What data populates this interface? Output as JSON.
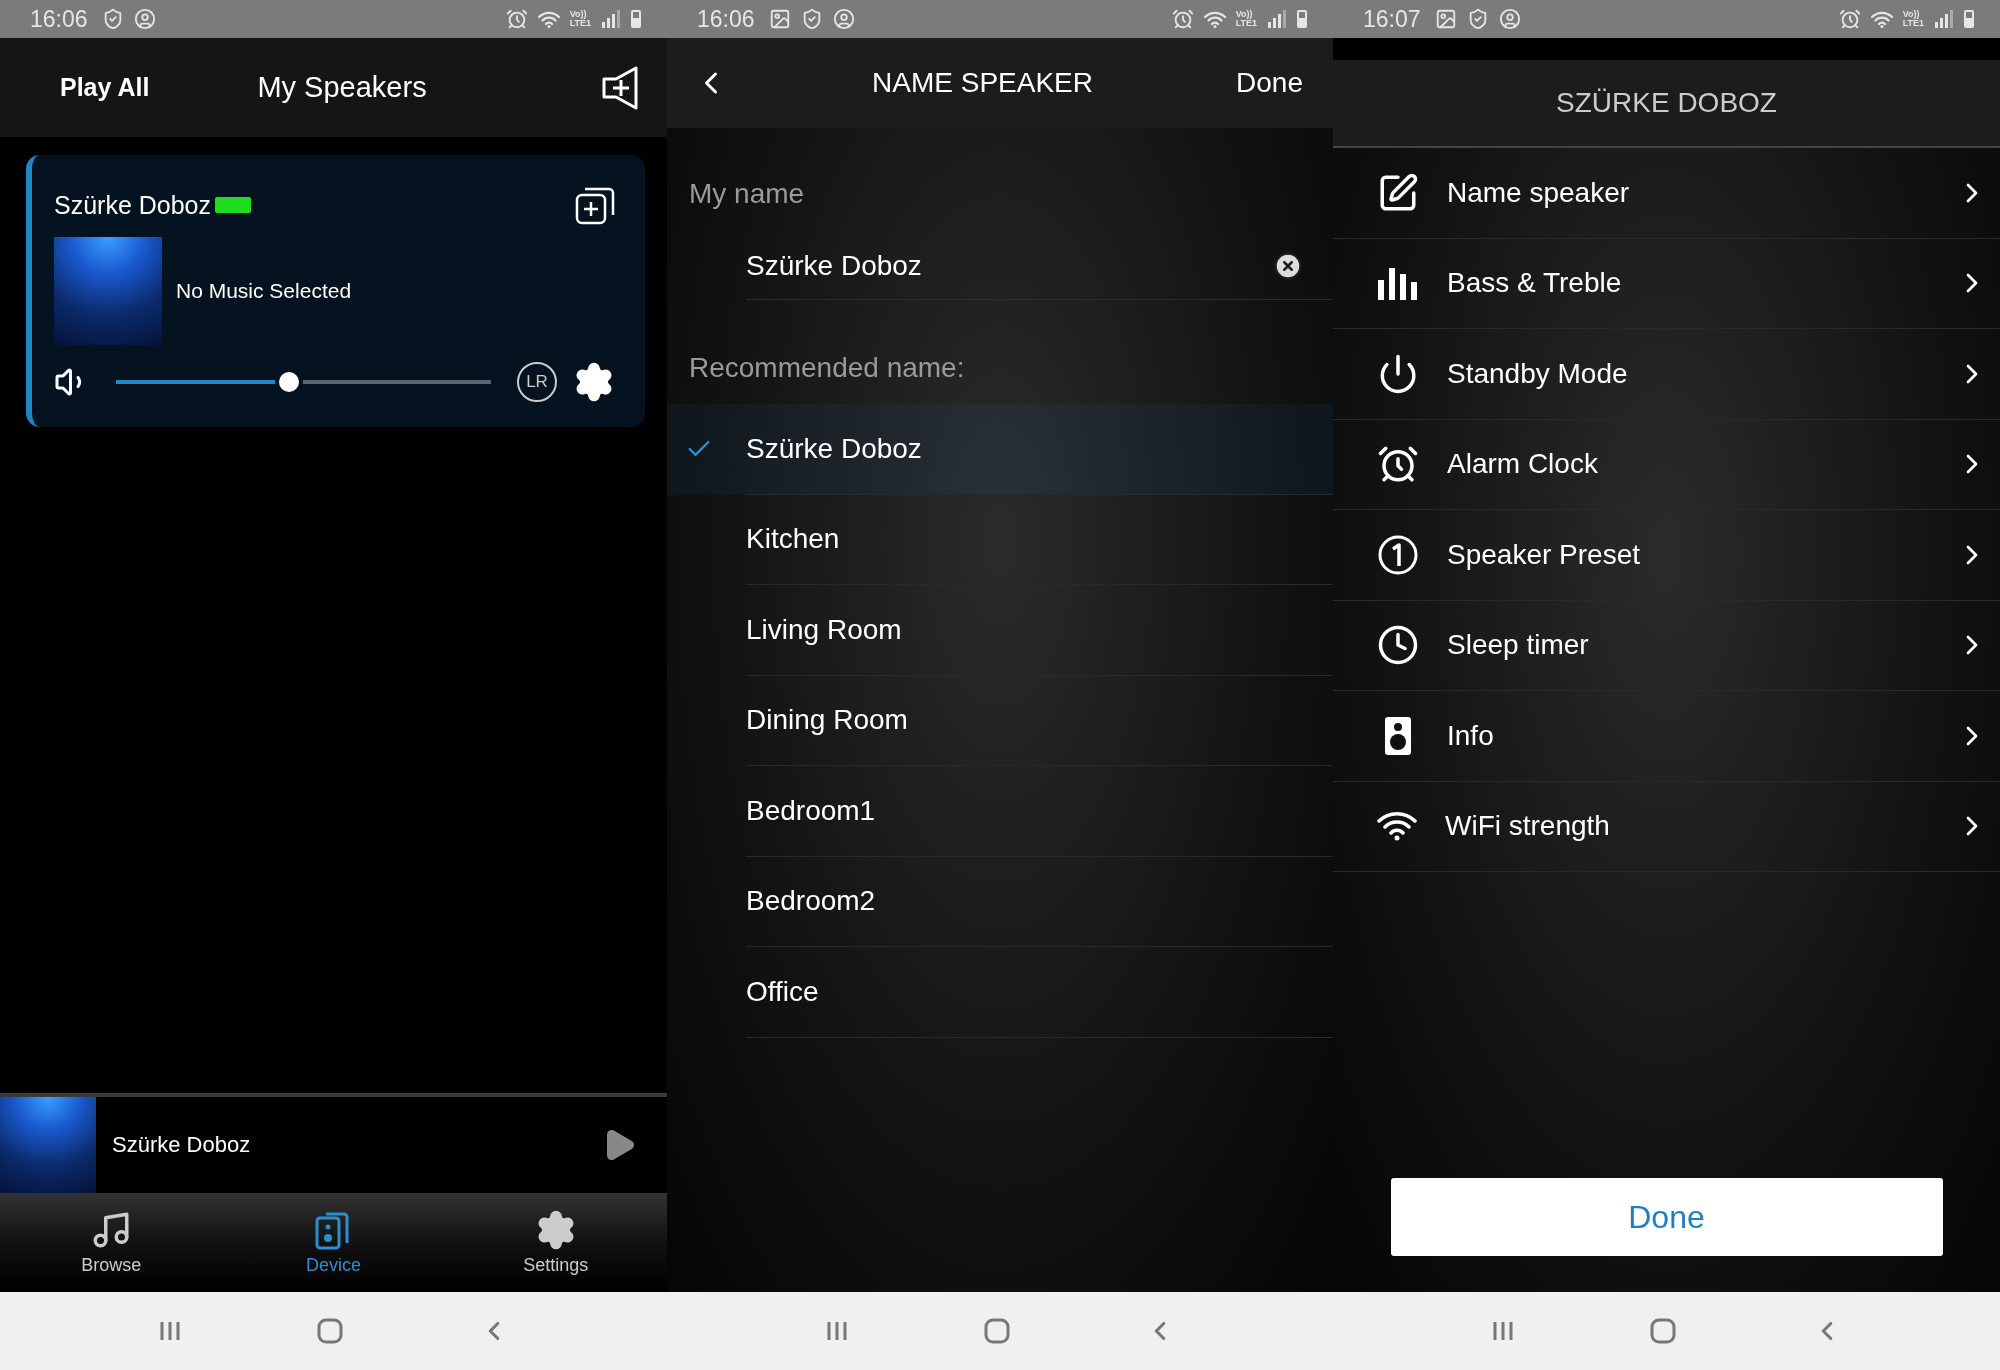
{
  "speakers_screen": {
    "status_bar": {
      "time": "16:06",
      "gallery_notification": false,
      "network": [
        "Vo))",
        "LTE1"
      ]
    },
    "header": {
      "play_all": "Play All",
      "title": "My Speakers"
    },
    "speaker_card": {
      "name": "Szürke Doboz",
      "track": "No Music Selected",
      "volume": {
        "level": 0.46
      },
      "channel_label": "LR"
    },
    "mini_player": {
      "title": "Szürke Doboz"
    },
    "tabs": [
      {
        "label": "Browse",
        "kind": "music",
        "selected": false
      },
      {
        "label": "Device",
        "kind": "device",
        "selected": true
      },
      {
        "label": "Settings",
        "kind": "gear",
        "selected": false
      }
    ]
  },
  "name_screen": {
    "status_bar": {
      "time": "16:06",
      "gallery_notification": true,
      "network": [
        "Vo))",
        "LTE1"
      ]
    },
    "header": {
      "title": "NAME SPEAKER",
      "done": "Done"
    },
    "my_name_label": "My name",
    "name_field": {
      "value": "Szürke Doboz"
    },
    "recommended_label": "Recommended name:",
    "names": [
      {
        "label": "Szürke Doboz",
        "selected": true
      },
      {
        "label": "Kitchen",
        "selected": false
      },
      {
        "label": "Living Room",
        "selected": false
      },
      {
        "label": "Dining Room",
        "selected": false
      },
      {
        "label": "Bedroom1",
        "selected": false
      },
      {
        "label": "Bedroom2",
        "selected": false
      },
      {
        "label": "Office",
        "selected": false
      }
    ]
  },
  "settings_screen": {
    "status_bar": {
      "time": "16:07",
      "gallery_notification": true,
      "network": [
        "Vo))",
        "LTE1"
      ]
    },
    "title": "SZÜRKE DOBOZ",
    "items": [
      {
        "label": "Name speaker",
        "kind": "edit"
      },
      {
        "label": "Bass & Treble",
        "kind": "equalizer"
      },
      {
        "label": "Standby Mode",
        "kind": "power"
      },
      {
        "label": "Alarm Clock",
        "kind": "alarm"
      },
      {
        "label": "Speaker Preset",
        "kind": "preset"
      },
      {
        "label": "Sleep timer",
        "kind": "timer"
      },
      {
        "label": "Info",
        "kind": "speaker"
      },
      {
        "label": "WiFi strength",
        "kind": "wifi"
      }
    ],
    "done": "Done"
  }
}
